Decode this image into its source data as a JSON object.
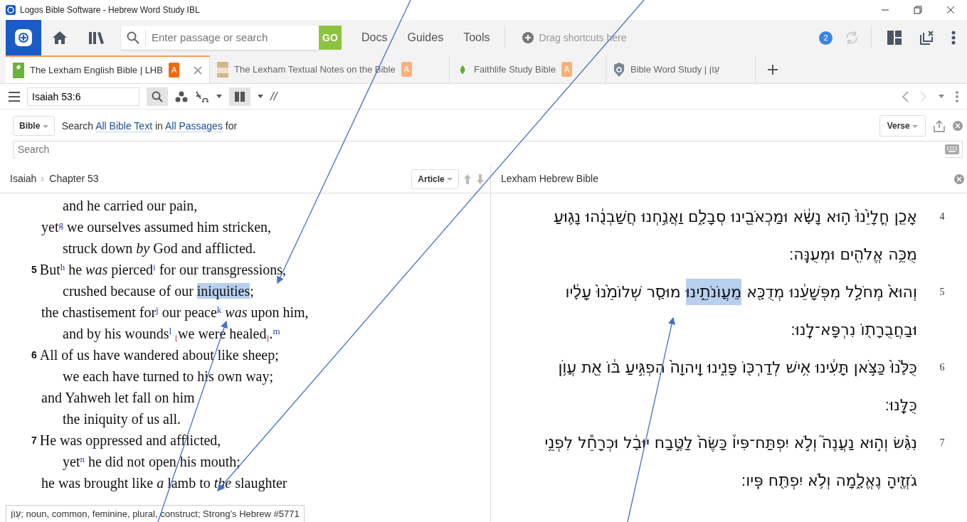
{
  "window": {
    "title": "Logos Bible Software - Hebrew Word Study IBL"
  },
  "toolbar": {
    "search": {
      "placeholder": "Enter passage or search"
    },
    "go": "GO",
    "menus": [
      "Docs",
      "Guides",
      "Tools"
    ],
    "shortcuts": "Drag shortcuts here",
    "notifications": "2"
  },
  "tabs": [
    {
      "label": "The Lexham English Bible | LHB",
      "badge": "A",
      "selected": true
    },
    {
      "label": "The Lexham Textual Notes on the Bible",
      "badge": "A",
      "selected": false
    },
    {
      "label": "Faithlife Study Bible",
      "badge": "A",
      "selected": false
    },
    {
      "label": "Bible Word Study | עָוֺן",
      "selected": false
    }
  ],
  "reference": {
    "value": "Isaiah 53:6"
  },
  "parallel": "//",
  "search_bar": {
    "scope": "Bible",
    "sentence": [
      {
        "text": "Search "
      },
      {
        "text": "All Bible Text",
        "link": true
      },
      {
        "text": " in "
      },
      {
        "text": "All Passages",
        "link": true
      },
      {
        "text": " for"
      }
    ],
    "view": "Verse",
    "placeholder": "Search"
  },
  "left_panel": {
    "breadcrumb": [
      "Isaiah",
      "Chapter 53"
    ],
    "view": "Article",
    "lines": [
      {
        "kind": "indented",
        "segments": [
          {
            "text": "and he carried our pain,"
          }
        ]
      },
      {
        "kind": "line",
        "segments": [
          {
            "text": "yet$^{g}$ we ourselves assumed him stricken,"
          }
        ]
      },
      {
        "kind": "indented",
        "segments": [
          {
            "text": "struck down *by* God and afflicted."
          }
        ]
      },
      {
        "kind": "line",
        "verse": "5",
        "segments": [
          {
            "text": "But$^{h}$ he *was* pierced$^{i}$ for our transgressions,"
          }
        ]
      },
      {
        "kind": "indented",
        "segments": [
          {
            "text": "crushed because of our "
          },
          {
            "text": "iniquities",
            "highlighted": true
          },
          {
            "text": ";"
          }
        ]
      },
      {
        "kind": "line",
        "segments": [
          {
            "text": "the chastisement for$^{j}$ our peace$^{k}$ *was* upon him,"
          }
        ]
      },
      {
        "kind": "indented",
        "segments": [
          {
            "text": "and by his wounds$^{l}$ $_{⌊}$we were healed$_{⌋}$.$^{m}$"
          }
        ]
      },
      {
        "kind": "line",
        "verse": "6",
        "segments": [
          {
            "text": "All of us have wandered about like sheep;"
          }
        ]
      },
      {
        "kind": "indented",
        "segments": [
          {
            "text": "we each have turned to his own way;"
          }
        ]
      },
      {
        "kind": "line",
        "segments": [
          {
            "text": "and Yahweh let fall on him"
          }
        ]
      },
      {
        "kind": "indented",
        "segments": [
          {
            "text": "the iniquity of us all."
          }
        ]
      },
      {
        "kind": "line",
        "verse": "7",
        "segments": [
          {
            "text": "He was oppressed and afflicted,"
          }
        ]
      },
      {
        "kind": "indented",
        "segments": [
          {
            "text": "yet$^{n}$ he did not open his mouth;"
          }
        ]
      },
      {
        "kind": "line",
        "segments": [
          {
            "text": "he was brought like *a* lamb to *the* slaughter"
          }
        ]
      }
    ]
  },
  "right_panel": {
    "title": "Lexham Hebrew Bible",
    "verses": [
      {
        "number": "4",
        "lines": [
          [
            {
              "text": "אָכֵ֤ן חֳלָיֵ֙נוּ֙ ה֣וּא נָשָׂ֔א וּמַכְאֹבֵ֖ינוּ סְבָלָ֑ם וַאֲנַ֣חְנוּ חֲשַׁבְנֻ֔הוּ נָג֛וּעַ"
            }
          ],
          [
            {
              "text": "מֻכֵּ֥ה אֱלֹהִ֖ים וּמְעֻנֶּֽה׃"
            }
          ]
        ]
      },
      {
        "number": "5",
        "lines": [
          [
            {
              "text": "וְהוּא֙ מְחֹלָ֣ל מִפְּשָׁעֵ֔נוּ מְדֻכָּ֖א "
            },
            {
              "text": "מֵעֲוֺנֹתֵ֑ינוּ",
              "highlighted": true
            },
            {
              "text": " מוּסַ֤ר שְׁלוֹמֵ֙נוּ֙ עָלָ֔יו"
            }
          ],
          [
            {
              "text": "וּבַחֲבֻרָת֖וֹ נִרְפָּא־לָֽנוּ׃"
            }
          ]
        ]
      },
      {
        "number": "6",
        "lines": [
          [
            {
              "text": "כֻּלָּ֙נוּ֙ כַּצֹּ֣אן תָּעִ֔ינוּ אִ֥ישׁ לְדַרְכּ֖וֹ פָּנִ֑ינוּ וַֽיהוָה֙ הִפְגִּ֣יעַ בּ֔וֹ אֵ֖ת עֲוֺ֥ן"
            }
          ],
          [
            {
              "text": "כֻּלָּֽנוּ׃"
            }
          ]
        ]
      },
      {
        "number": "7",
        "lines": [
          [
            {
              "text": "נִגַּ֨שׂ וְה֣וּא נַעֲנֶה֮ וְלֹ֣א יִפְתַּח־פִּיו֒ כַּשֶּׂה֙ לַטֶּ֣בַח יוּבָ֔ל וּכְרָחֵ֕ל לִפְנֵ֥י"
            }
          ],
          [
            {
              "text": "גֹזְזֶ֖יהָ נֶאֱלָ֑מָה וְלֹ֥א יִפְתַּ֖ח פִּֽיו׃"
            }
          ]
        ]
      }
    ]
  },
  "tooltip": "עָוֺן; noun, common, feminine, plural, construct; Strong’s Hebrew #5771"
}
